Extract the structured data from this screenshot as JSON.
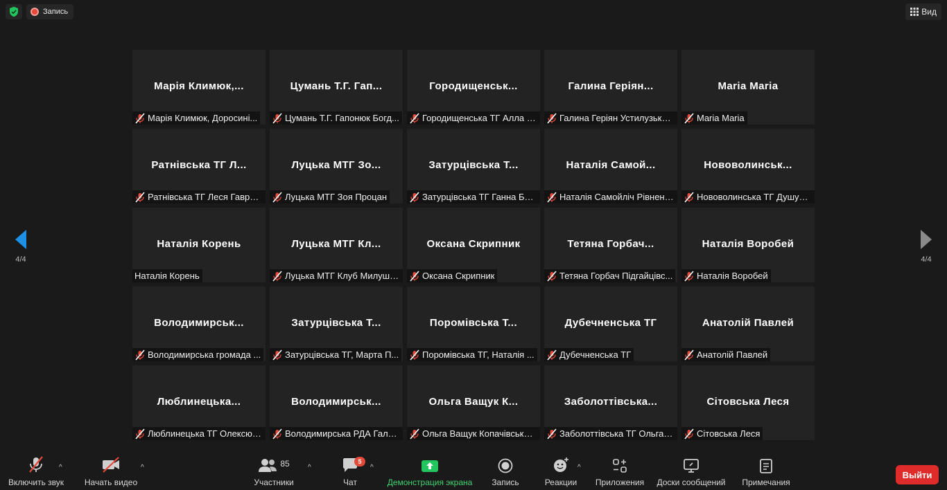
{
  "topbar": {
    "recording_label": "Запись",
    "view_label": "Вид",
    "shield_icon": "security-shield-icon",
    "colors": {
      "shield": "#22c55e",
      "record": "#e9473a"
    }
  },
  "pager": {
    "indicator": "4/4"
  },
  "tiles": [
    {
      "title": "Марія  Климюк,...",
      "name": "Марія Климюк, Доросині...",
      "muted": true
    },
    {
      "title": "Цумань Т.Г. Гап...",
      "name": "Цумань Т.Г. Гапонюк Богд...",
      "muted": true
    },
    {
      "title": "Городищенськ...",
      "name": "Городищенська ТГ Алла Г...",
      "muted": true
    },
    {
      "title": "Галина  Геріян...",
      "name": "Галина Геріян Устилузька ...",
      "muted": true
    },
    {
      "title": "Maria Maria",
      "name": "Maria Maria",
      "muted": true
    },
    {
      "title": "Ратнівська ТГ Л...",
      "name": "Ратнівська ТГ Леся Гаврил...",
      "muted": true
    },
    {
      "title": "Луцька МТГ Зо...",
      "name": "Луцька МТГ Зоя Процан",
      "muted": true
    },
    {
      "title": "Затурцівська Т...",
      "name": "Затурцівська ТГ Ганна Баз...",
      "muted": true
    },
    {
      "title": "Наталія  Самой...",
      "name": "Наталія Самойліч Рівненс...",
      "muted": true
    },
    {
      "title": "Нововолинськ...",
      "name": "Нововолинська ТГ Душук ...",
      "muted": true
    },
    {
      "title": "Наталія Корень",
      "name": "Наталія Корень",
      "muted": false
    },
    {
      "title": "Луцька МТГ Кл...",
      "name": "Луцька МТГ Клуб Милуші ...",
      "muted": true
    },
    {
      "title": "Оксана Скрипник",
      "name": "Оксана Скрипник",
      "muted": true
    },
    {
      "title": "Тетяна  Горбач...",
      "name": "Тетяна Горбач Підгайцівс...",
      "muted": true
    },
    {
      "title": "Наталія Воробей",
      "name": "Наталія Воробей",
      "muted": true
    },
    {
      "title": "Володимирськ...",
      "name": "Володимирська громада ...",
      "muted": true
    },
    {
      "title": "Затурцівська Т...",
      "name": "Затурцівська ТГ, Марта П...",
      "muted": true
    },
    {
      "title": "Поромівська Т...",
      "name": "Поромівська ТГ, Наталія ...",
      "muted": true
    },
    {
      "title": "Дубечненська ТГ",
      "name": "Дубечненська ТГ",
      "muted": true
    },
    {
      "title": "Анатолій Павлей",
      "name": "Анатолій Павлей",
      "muted": true
    },
    {
      "title": "Люблинецька...",
      "name": "Люблинецька ТГ Олексюк...",
      "muted": true
    },
    {
      "title": "Володимирськ...",
      "name": "Володимирська РДА Гали...",
      "muted": true
    },
    {
      "title": "Ольга Ващук К...",
      "name": "Ольга Ващук Копачівська ...",
      "muted": true
    },
    {
      "title": "Заболоттівська...",
      "name": "Заболоттівська ТГ Ольга Г...",
      "muted": true
    },
    {
      "title": "Сітовська Леся",
      "name": "Сітовська Леся",
      "muted": true
    }
  ],
  "toolbar": {
    "unmute": "Включить звук",
    "start_video": "Начать видео",
    "participants": "Участники",
    "participants_count": "85",
    "chat": "Чат",
    "chat_badge": "5",
    "share_screen": "Демонстрация экрана",
    "record": "Запись",
    "reactions": "Реакции",
    "apps": "Приложения",
    "whiteboards": "Доски сообщений",
    "notes": "Примечания",
    "leave": "Выйти",
    "colors": {
      "share": "#22c55e",
      "leave": "#e02b2b",
      "muted": "#e34a3a"
    }
  }
}
